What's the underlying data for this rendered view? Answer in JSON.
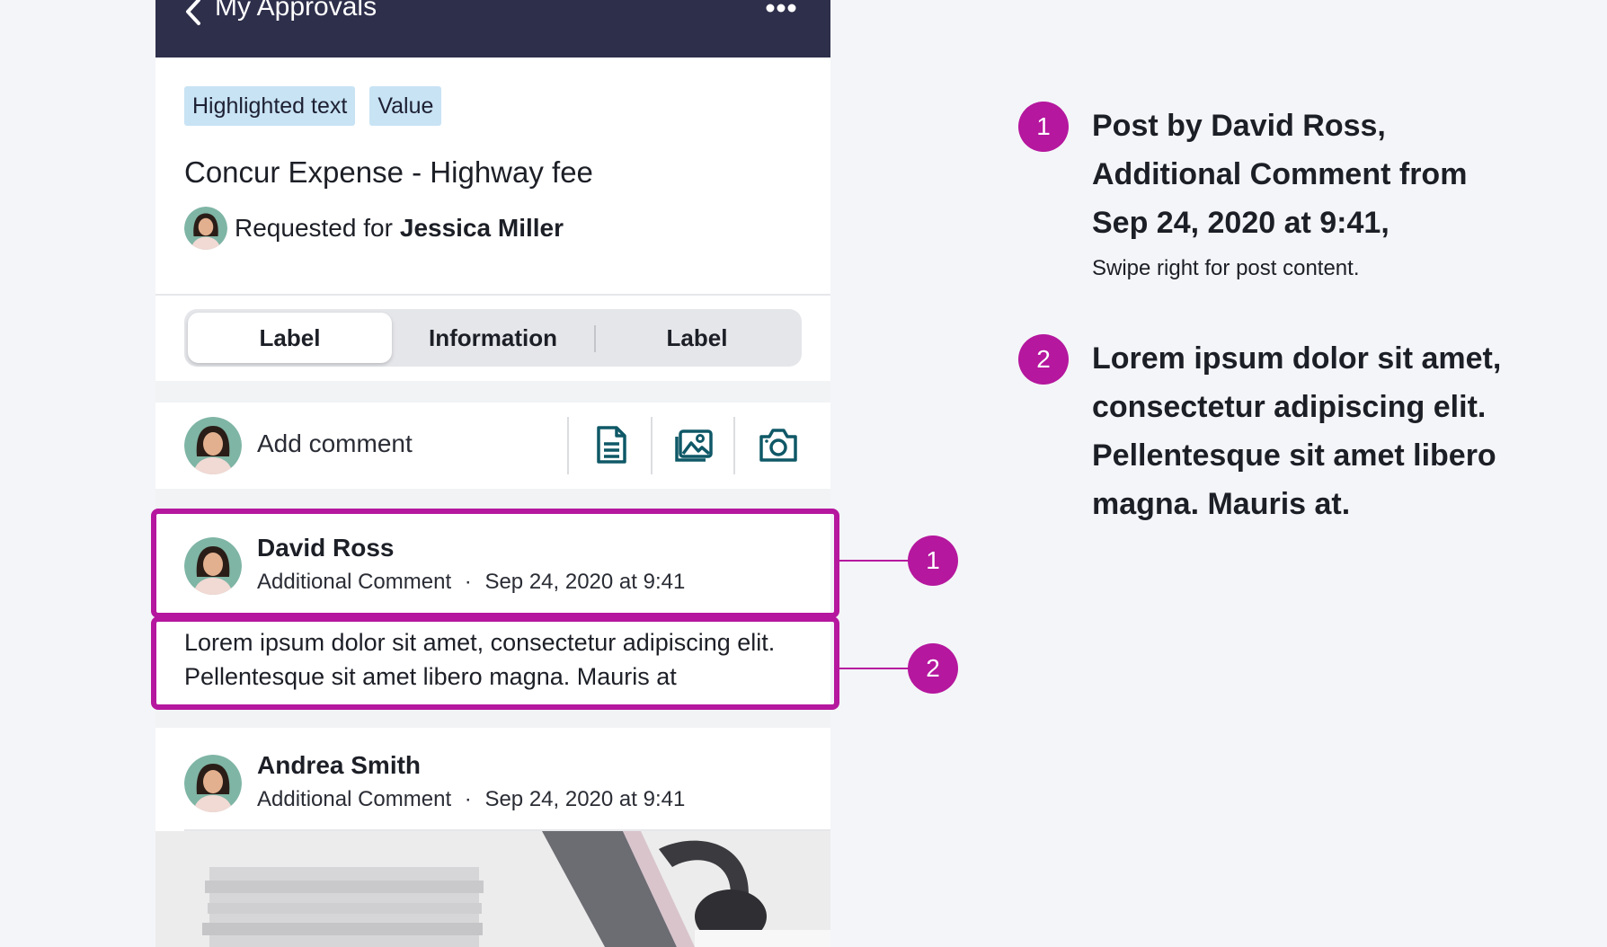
{
  "header": {
    "title": "My Approvals"
  },
  "tags": [
    "Highlighted text",
    "Value"
  ],
  "record": {
    "title": "Concur Expense - Highway fee",
    "requested_prefix": "Requested for",
    "requested_name": "Jessica Miller"
  },
  "segments": [
    "Label",
    "Information",
    "Label"
  ],
  "add_comment": {
    "placeholder": "Add comment"
  },
  "posts": [
    {
      "name": "David Ross",
      "type": "Additional Comment",
      "time": "Sep 24, 2020 at 9:41",
      "body": "Lorem ipsum dolor sit amet, consectetur adipiscing elit. Pellentesque sit amet libero magna. Mauris at"
    },
    {
      "name": "Andrea Smith",
      "type": "Additional Comment",
      "time": "Sep 24, 2020 at 9:41"
    }
  ],
  "separator": "·",
  "callouts": [
    {
      "number": "1",
      "text": "Post by David Ross, Additional Comment from Sep 24, 2020 at 9:41,",
      "sub": "Swipe right for post content."
    },
    {
      "number": "2",
      "text": "Lorem ipsum dolor sit amet, consectetur adipiscing elit. Pellentesque sit amet libero magna. Mauris at."
    }
  ],
  "colors": {
    "header": "#2e2f4b",
    "accent": "#b5179e",
    "tag": "#c8e3f4",
    "icon": "#0f5867"
  }
}
